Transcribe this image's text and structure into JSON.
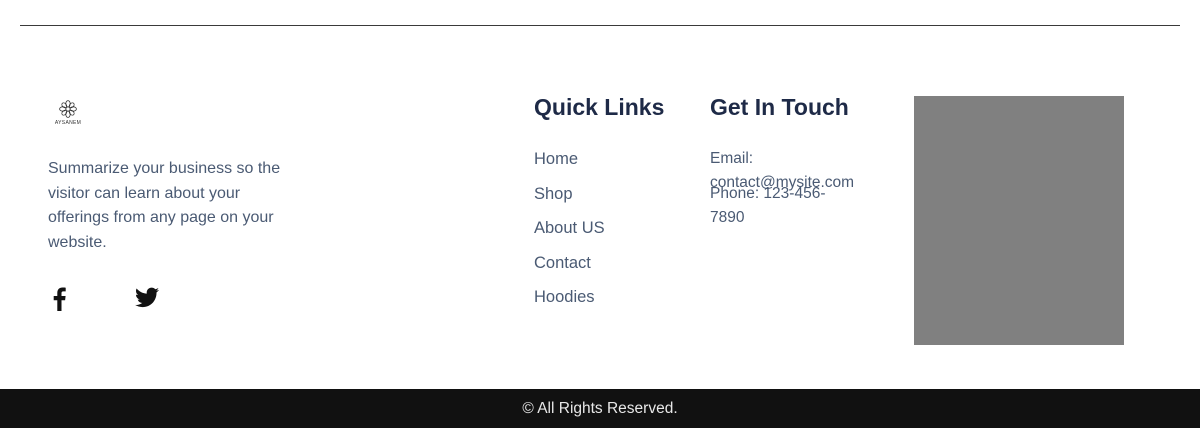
{
  "brand": {
    "logo_text": "AYSANEM",
    "logo_icon": "ornament-icon"
  },
  "about": {
    "summary": "Summarize your business so the visitor can learn about your offerings from any page on your website."
  },
  "social": [
    {
      "name": "facebook",
      "icon": "facebook-icon"
    },
    {
      "name": "twitter",
      "icon": "twitter-icon"
    }
  ],
  "quick_links": {
    "title": "Quick Links",
    "items": [
      "Home",
      "Shop",
      "About US",
      "Contact",
      "Hoodies"
    ]
  },
  "get_in_touch": {
    "title": "Get In Touch",
    "email": "Email: contact@mysite.com",
    "phone": "Phone: 123-456-7890"
  },
  "map": {
    "color": "#808080"
  },
  "footer": {
    "copyright": "© All Rights Reserved.",
    "background": "#111111"
  }
}
